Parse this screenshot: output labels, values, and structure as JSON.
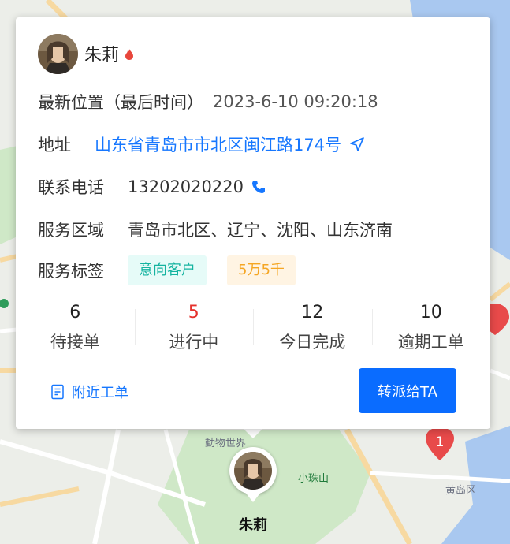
{
  "staff": {
    "name": "朱莉",
    "last_location_label": "最新位置（最后时间）",
    "last_location_time": "2023-6-10 09:20:18",
    "address_label": "地址",
    "address": "山东省青岛市市北区闽江路174号",
    "phone_label": "联系电话",
    "phone": "13202020220",
    "service_area_label": "服务区域",
    "service_area": "青岛市北区、辽宁、沈阳、山东济南",
    "service_tags_label": "服务标签",
    "tags": [
      "意向客户",
      "5万5千"
    ]
  },
  "stats": [
    {
      "value": "6",
      "label": "待接单"
    },
    {
      "value": "5",
      "label": "进行中"
    },
    {
      "value": "12",
      "label": "今日完成"
    },
    {
      "value": "10",
      "label": "逾期工单"
    }
  ],
  "actions": {
    "nearby_label": "附近工单",
    "dispatch_label": "转派给TA"
  },
  "map": {
    "pin_count": "1",
    "marker_name": "朱莉"
  },
  "colors": {
    "link": "#1677ff",
    "primary_button": "#0a6cff",
    "in_progress": "#e5322d",
    "pin": "#e84a4a"
  }
}
